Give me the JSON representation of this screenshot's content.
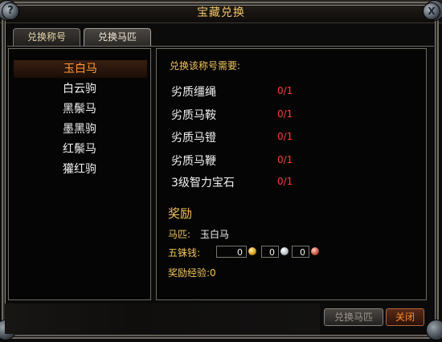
{
  "window": {
    "title": "宝藏兑换",
    "help_glyph": "?",
    "close_glyph": "X"
  },
  "tabs": [
    {
      "label": "兑换称号",
      "active": false
    },
    {
      "label": "兑换马匹",
      "active": true
    }
  ],
  "horses": [
    {
      "label": "玉白马",
      "selected": true
    },
    {
      "label": "白云驹",
      "selected": false
    },
    {
      "label": "黑鬃马",
      "selected": false
    },
    {
      "label": "墨黑驹",
      "selected": false
    },
    {
      "label": "红鬃马",
      "selected": false
    },
    {
      "label": "獾红驹",
      "selected": false
    }
  ],
  "requirements": {
    "header": "兑换该称号需要:",
    "items": [
      {
        "name": "劣质缰绳",
        "value": "0/1"
      },
      {
        "name": "劣质马鞍",
        "value": "0/1"
      },
      {
        "name": "劣质马镫",
        "value": "0/1"
      },
      {
        "name": "劣质马鞭",
        "value": "0/1"
      },
      {
        "name": "3级智力宝石",
        "value": "0/1"
      }
    ]
  },
  "reward": {
    "title": "奖励",
    "horse_label": "马匹:",
    "horse_value": "玉白马",
    "money_label": "五铢钱:",
    "money": [
      {
        "amount": "0",
        "coin": "gold"
      },
      {
        "amount": "0",
        "coin": "silver"
      },
      {
        "amount": "0",
        "coin": "copper"
      }
    ],
    "exp_label": "奖励经验:",
    "exp_value": "0"
  },
  "buttons": {
    "exchange": "兑换马匹",
    "close": "关闭"
  },
  "colors": {
    "gold_text": "#f0c45a",
    "selected_orange": "#ff9a3c",
    "red_value": "#ff3b3b"
  }
}
